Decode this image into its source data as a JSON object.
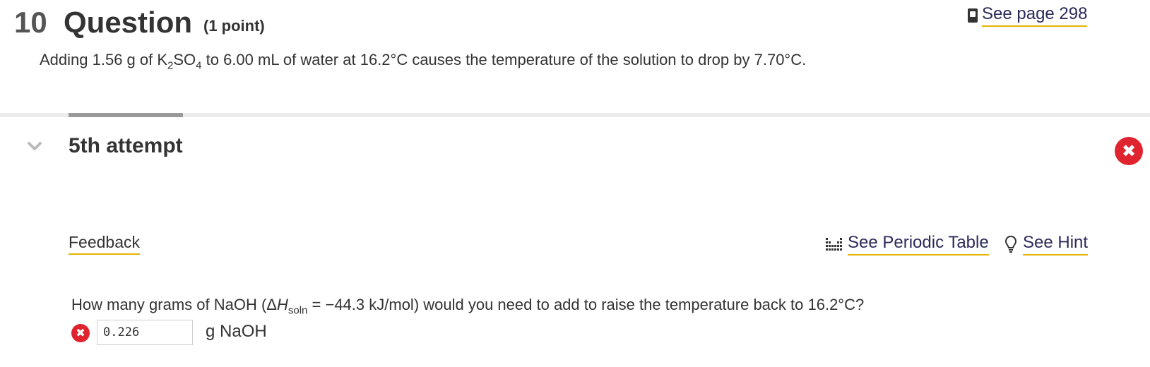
{
  "header": {
    "number": "10",
    "title": "Question",
    "points": "(1 point)",
    "see_page": "See page 298"
  },
  "prompt": {
    "text_1": "Adding 1.56 g of K",
    "sub_1": "2",
    "text_2": "SO",
    "sub_2": "4",
    "text_3": " to 6.00 mL of water at 16.2°C causes the temperature of the solution to drop by 7.70°C."
  },
  "attempt": {
    "label": "5th attempt",
    "status_icon": "x-circle-icon",
    "status_color": "#e0242f"
  },
  "links": {
    "feedback": "Feedback",
    "periodic_table": "See Periodic Table",
    "hint": "See Hint"
  },
  "question": {
    "text_1": "How many grams of NaOH (Δ",
    "h_symbol": "H",
    "h_sub": "soln",
    "text_2": " = −44.3 kJ/mol) would you need to add to raise the temperature back to 16.2°C?",
    "answer_value": "0.226",
    "unit": "g NaOH"
  }
}
